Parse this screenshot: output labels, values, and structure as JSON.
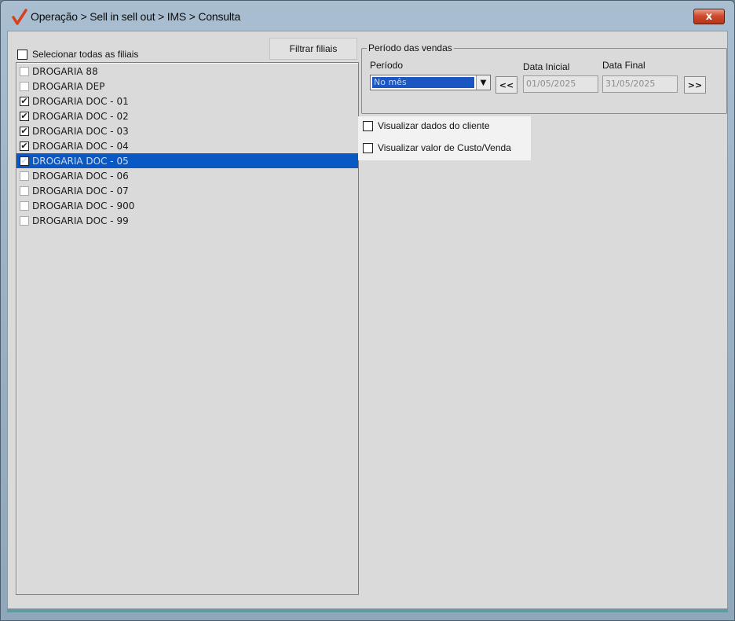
{
  "window": {
    "title": "Operação > Sell in sell out > IMS > Consulta",
    "close_label": "x"
  },
  "branches": {
    "select_all_label": "Selecionar todas as filiais",
    "filter_button_label": "Filtrar filiais",
    "items": [
      {
        "label": "DROGARIA 88",
        "checked": false,
        "selected": false
      },
      {
        "label": "DROGARIA DEP",
        "checked": false,
        "selected": false
      },
      {
        "label": "DROGARIA DOC - 01",
        "checked": true,
        "selected": false
      },
      {
        "label": "DROGARIA DOC - 02",
        "checked": true,
        "selected": false
      },
      {
        "label": "DROGARIA DOC - 03",
        "checked": true,
        "selected": false
      },
      {
        "label": "DROGARIA DOC - 04",
        "checked": true,
        "selected": false
      },
      {
        "label": "DROGARIA DOC - 05",
        "checked": true,
        "selected": true
      },
      {
        "label": "DROGARIA DOC - 06",
        "checked": false,
        "selected": false
      },
      {
        "label": "DROGARIA DOC - 07",
        "checked": false,
        "selected": false
      },
      {
        "label": "DROGARIA DOC - 900",
        "checked": false,
        "selected": false
      },
      {
        "label": "DROGARIA DOC - 99",
        "checked": false,
        "selected": false
      }
    ]
  },
  "period": {
    "group_title": "Período das vendas",
    "period_label": "Período",
    "period_value": "No mês",
    "start_label": "Data Inicial",
    "start_value": "01/05/2025",
    "end_label": "Data Final",
    "end_value": "31/05/2025",
    "prev_label": "<<",
    "next_label": ">>"
  },
  "options": {
    "show_client_label": "Visualizar dados do cliente",
    "show_cost_label": "Visualizar valor de Custo/Venda"
  },
  "colors": {
    "selection": "#0a58c4",
    "accent_check": "#d6401a"
  }
}
